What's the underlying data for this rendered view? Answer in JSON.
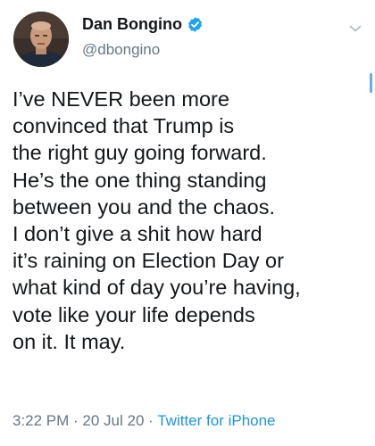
{
  "tweet": {
    "author_name": "Dan Bongino",
    "handle": "@dbongino",
    "verified": true,
    "text_lines": [
      "I’ve NEVER been more",
      "convinced that Trump is",
      "the right guy going forward.",
      "He’s the one thing standing",
      "between you and the chaos.",
      "I don’t give a shit how hard",
      "it’s raining on Election Day or",
      "what kind of day you’re having,",
      "vote like your life depends",
      "on it. It may."
    ],
    "time": "3:22 PM",
    "separator": " · ",
    "date": "20 Jul 20",
    "source": "Twitter for iPhone"
  },
  "icons": {
    "verified": "verified-badge-icon",
    "menu": "chevron-down-icon",
    "avatar": "profile-photo"
  },
  "colors": {
    "text": "#14171a",
    "secondary": "#657786",
    "link": "#1b95e0",
    "verified": "#1da1f2",
    "scrollbar": "#6aa9f0"
  }
}
